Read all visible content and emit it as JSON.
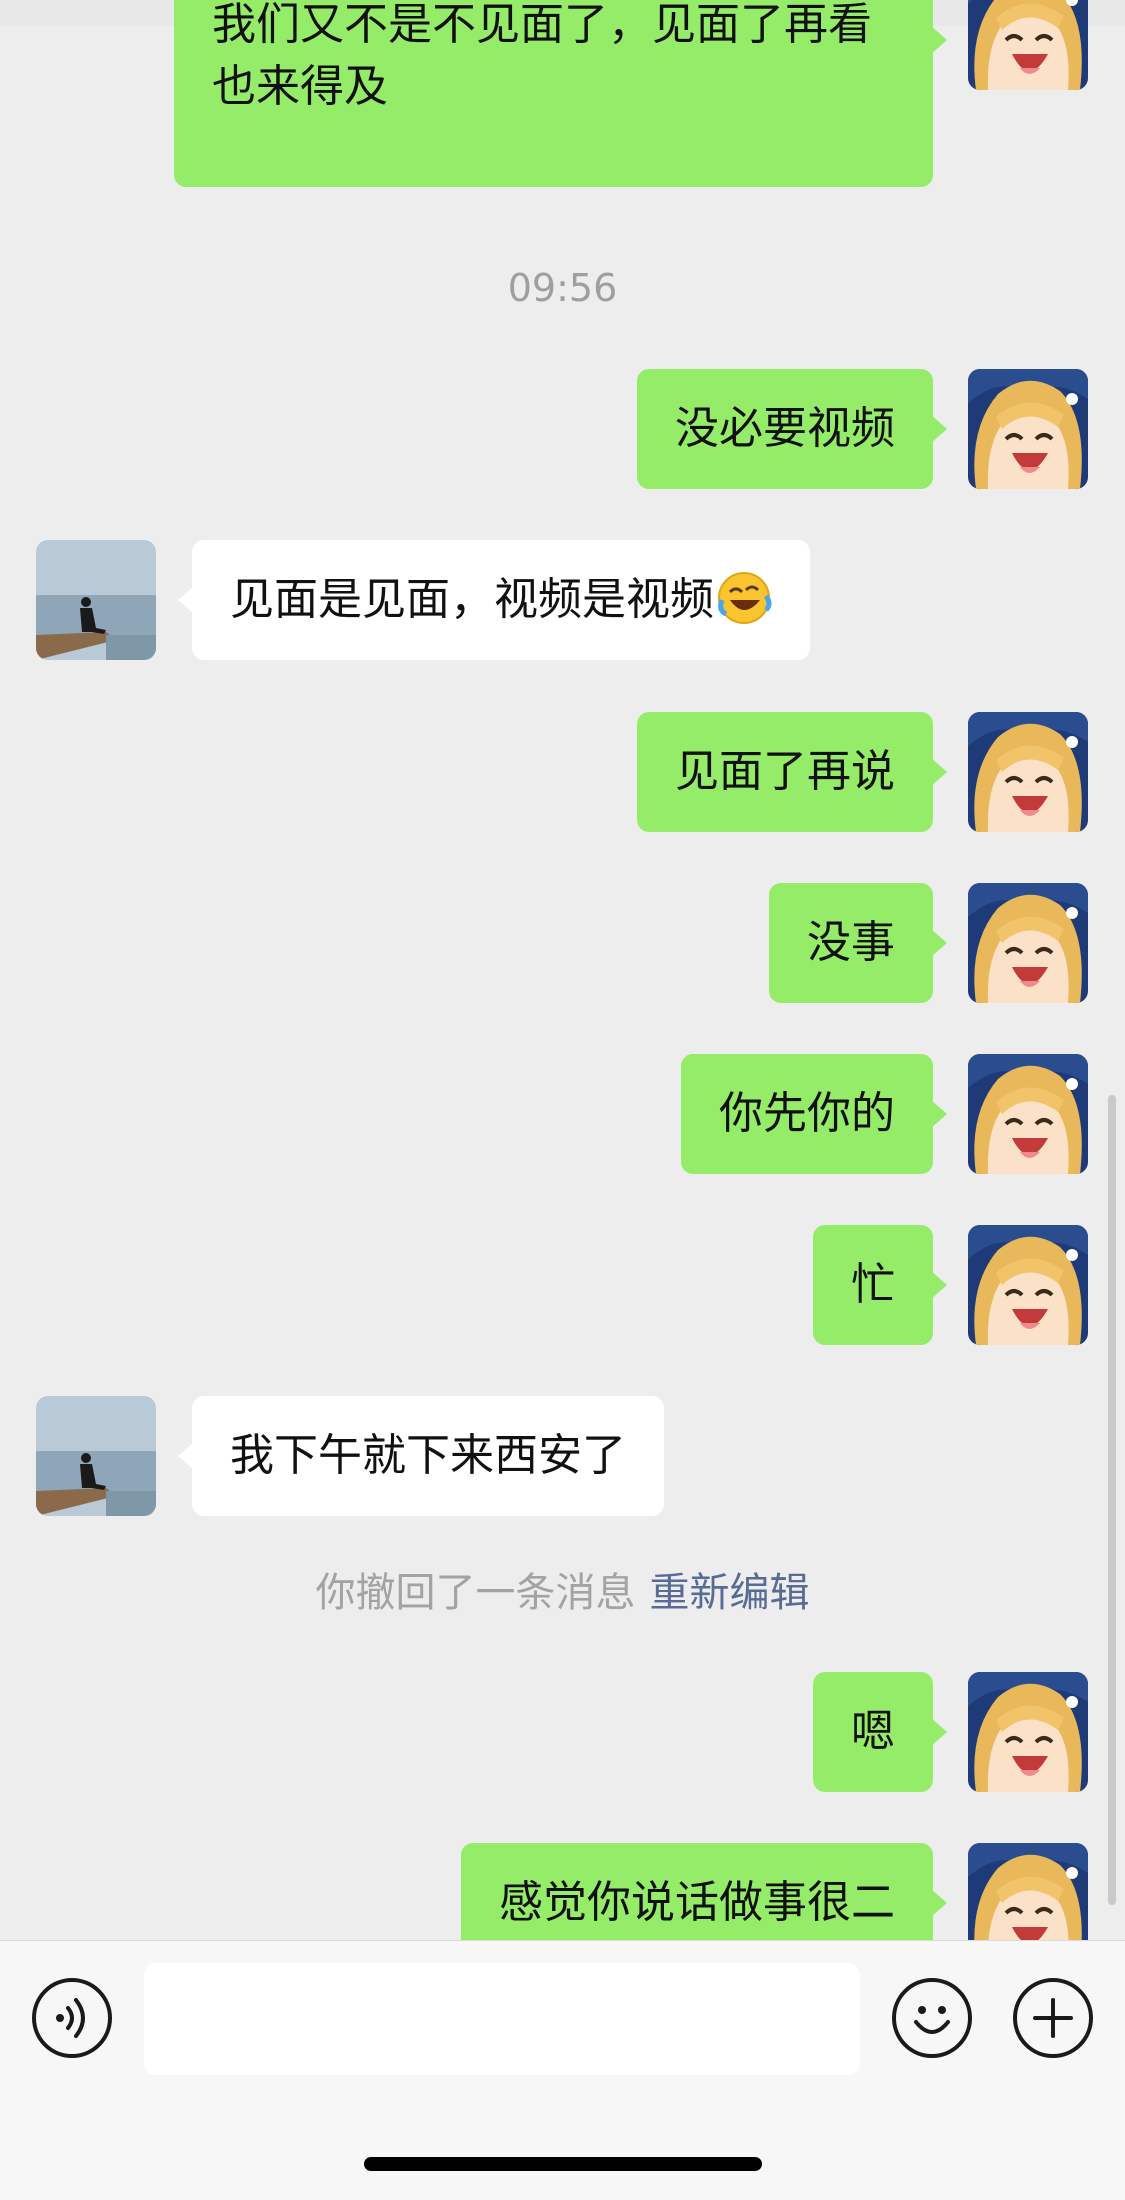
{
  "conversation": {
    "messages": [
      {
        "text": "我们又不是不见面了，见面了再看也来得及"
      },
      {
        "time": "09:56"
      },
      {
        "text": "没必要视频"
      },
      {
        "text": "见面是见面，视频是视频",
        "emoji": "rolling-on-floor-laughing-emoji"
      },
      {
        "text": "见面了再说"
      },
      {
        "text": "没事"
      },
      {
        "text": "你先你的"
      },
      {
        "text": "忙"
      },
      {
        "text": "我下午就下来西安了"
      },
      {
        "system": "你撤回了一条消息",
        "link": "重新编辑"
      },
      {
        "text": "嗯"
      },
      {
        "text": "感觉你说话做事很二"
      }
    ]
  },
  "input_bar": {
    "voice_icon": "voice-icon",
    "emoji_icon": "smiley-icon",
    "plus_icon": "plus-icon",
    "text_value": ""
  },
  "colors": {
    "background": "#ededed",
    "my_bubble": "#95ec69",
    "their_bubble": "#ffffff",
    "link": "#576b95"
  }
}
